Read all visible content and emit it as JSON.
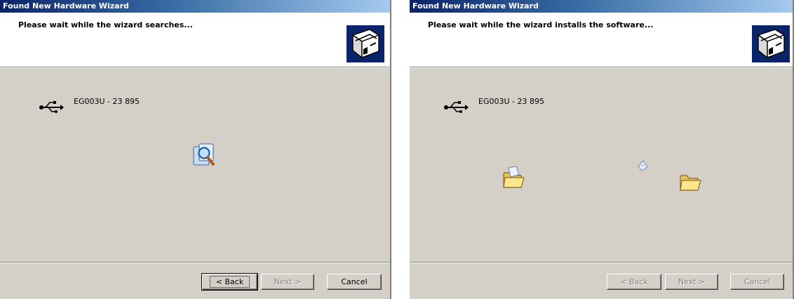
{
  "left": {
    "title": "Found New Hardware Wizard",
    "header_text": "Please wait while the wizard searches...",
    "device": "EG003U - 23 895",
    "buttons": {
      "back": "< Back",
      "next": "Next >",
      "cancel": "Cancel"
    }
  },
  "right": {
    "title": "Found New Hardware Wizard",
    "header_text": "Please wait while the wizard installs the software...",
    "device": "EG003U - 23 895",
    "buttons": {
      "back": "< Back",
      "next": "Next >",
      "cancel": "Cancel"
    }
  },
  "icons": {
    "hardware": "hardware-wizard-icon",
    "usb": "usb-icon",
    "search": "magnifier-search-icon",
    "folder": "folder-icon",
    "document": "flying-document-icon"
  },
  "colors": {
    "titlebar_start": "#0a246a",
    "titlebar_end": "#a6caf0",
    "dialog_bg": "#d4d0c8"
  }
}
